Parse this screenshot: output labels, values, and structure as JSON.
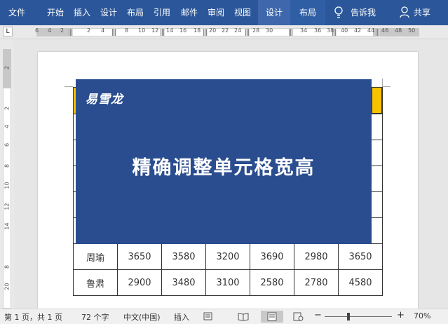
{
  "ribbon": {
    "tabs": [
      "文件",
      "开始",
      "插入",
      "设计",
      "布局",
      "引用",
      "邮件",
      "审阅",
      "视图",
      "设计",
      "布局"
    ],
    "tell_me": "告诉我",
    "share": "共享"
  },
  "ruler": {
    "corner": "L",
    "h_ticks": [
      "6",
      "4",
      "2",
      "2",
      "4",
      "8",
      "10",
      "12",
      "14",
      "16",
      "18",
      "20",
      "22",
      "24",
      "28",
      "30",
      "34",
      "36",
      "38",
      "40",
      "42",
      "44",
      "46",
      "48",
      "50"
    ],
    "v_ticks": [
      "2",
      "2",
      "4",
      "6",
      "8",
      "10",
      "12",
      "14",
      "8",
      "20"
    ]
  },
  "banner": {
    "brand": "易雪龙",
    "headline": "精确调整单元格宽高"
  },
  "table": {
    "rows": [
      [
        "周瑜",
        "3650",
        "3580",
        "3200",
        "3690",
        "2980",
        "3650"
      ],
      [
        "鲁肃",
        "2900",
        "3480",
        "3100",
        "2580",
        "2780",
        "4580"
      ]
    ]
  },
  "status": {
    "page": "第 1 页，共 1 页",
    "words": "72 个字",
    "language": "中文(中国)",
    "mode": "插入",
    "zoom_minus": "−",
    "zoom_plus": "+",
    "zoom": "70%"
  },
  "colors": {
    "ribbon": "#2b579a",
    "banner": "#2a4d8f",
    "header_cell": "#f7c200"
  }
}
